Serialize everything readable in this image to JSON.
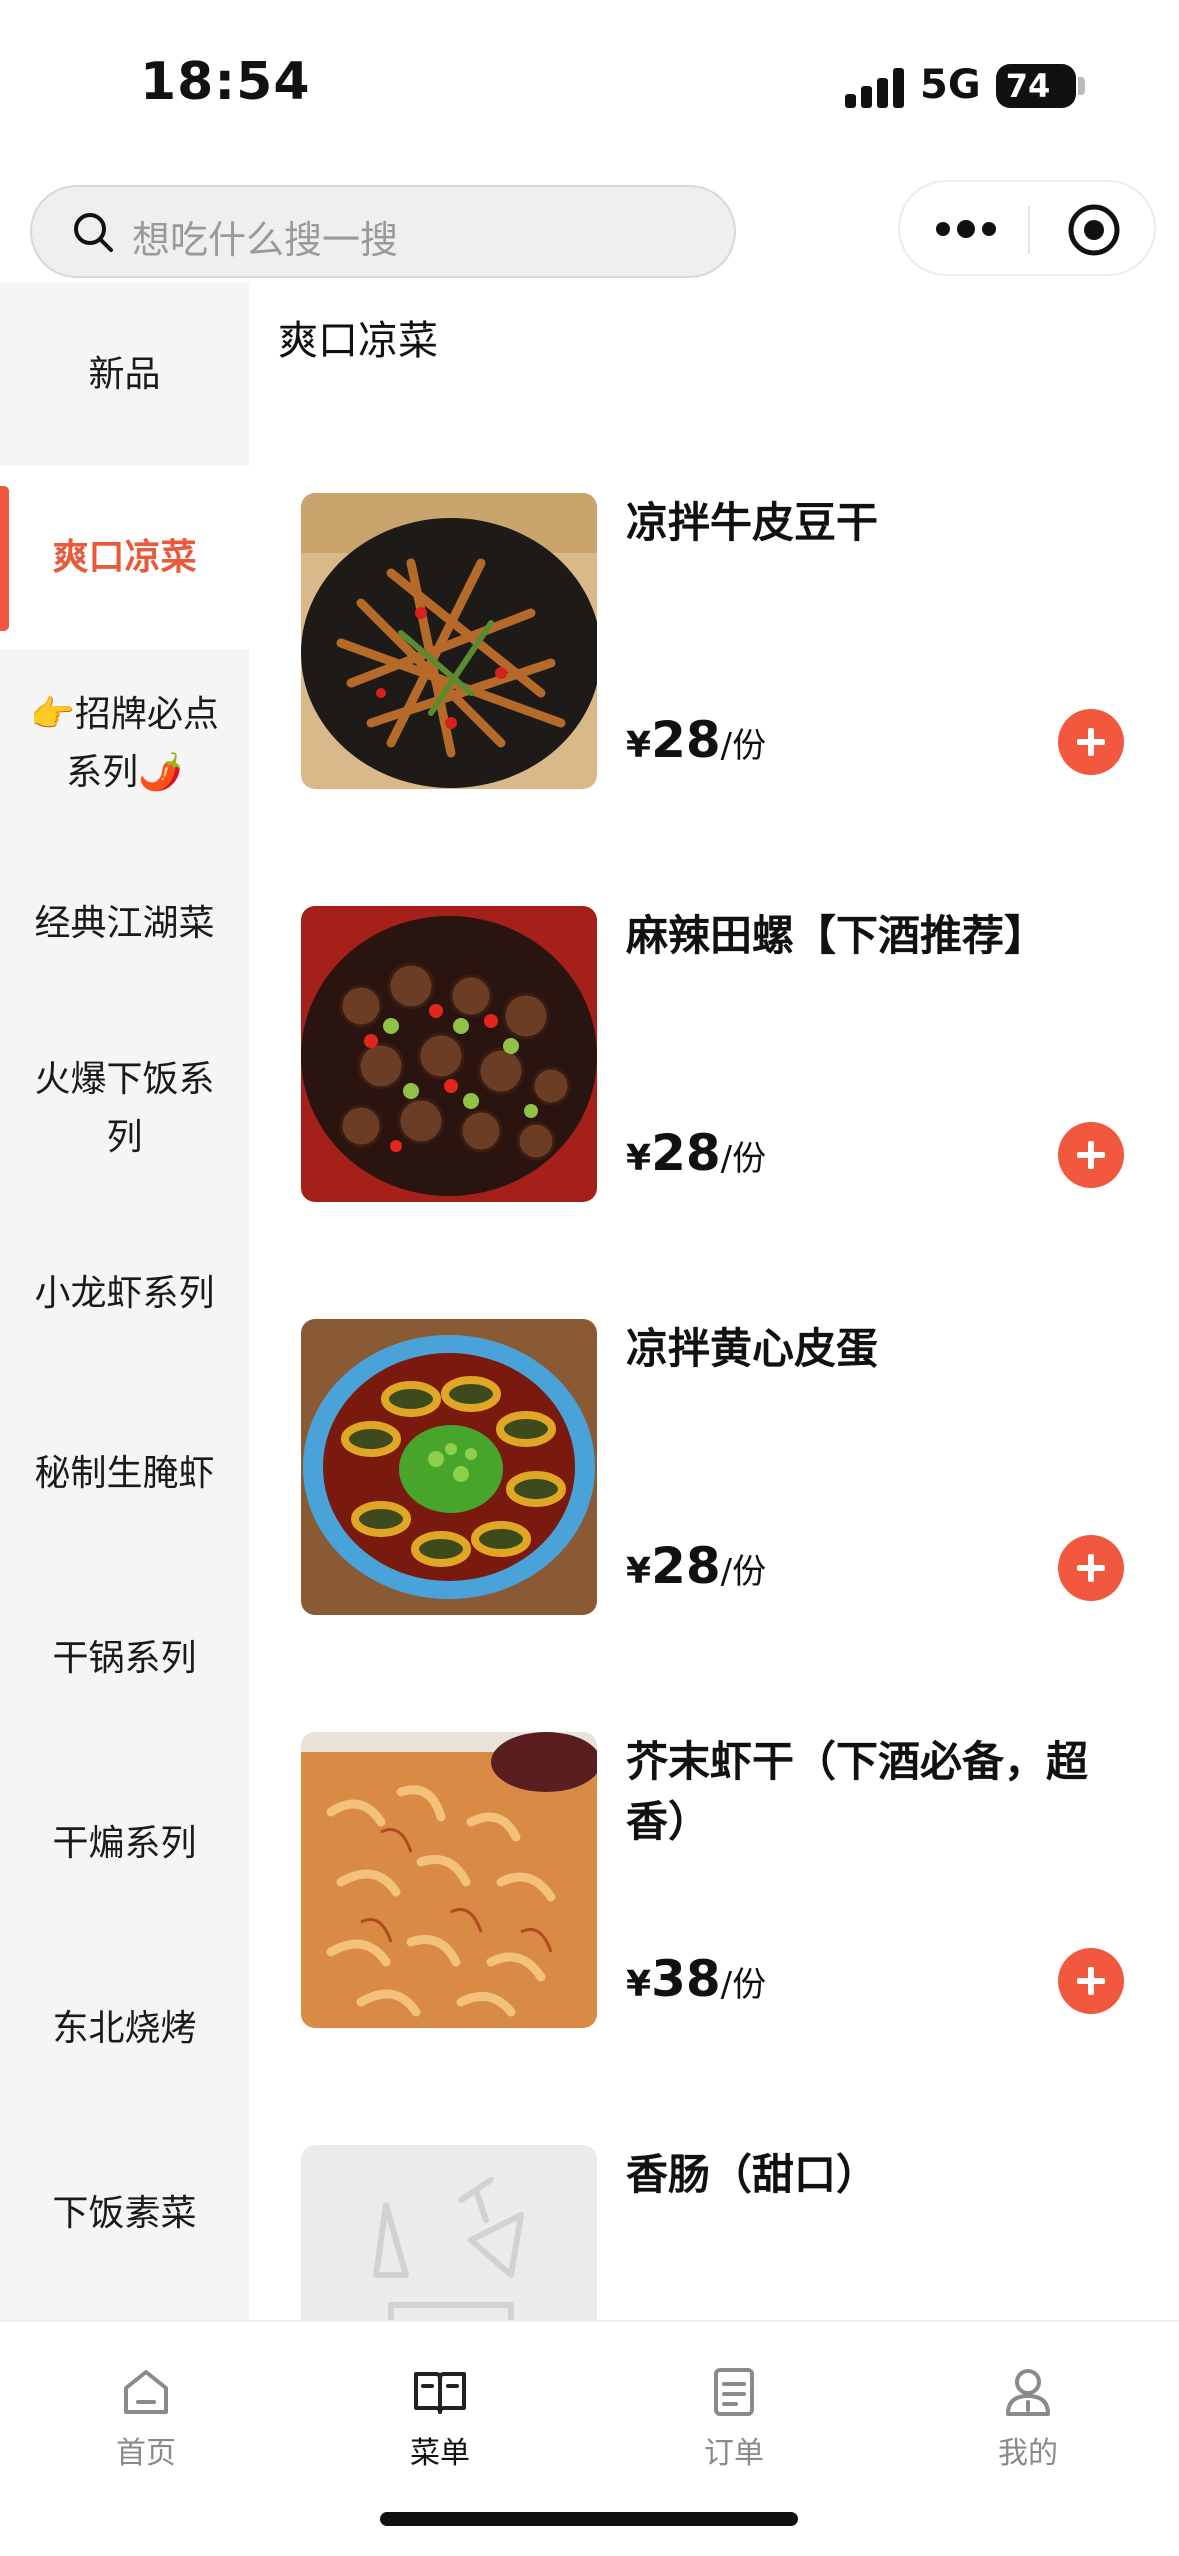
{
  "status_bar": {
    "time": "18:54",
    "network": "5G",
    "battery": "74"
  },
  "search": {
    "placeholder": "想吃什么搜一搜",
    "icon": "search-icon"
  },
  "capsule": {
    "more_icon": "more-dots-icon",
    "close_icon": "target-circle-icon"
  },
  "sidebar": {
    "items": [
      {
        "label": "新品"
      },
      {
        "label": "爽口凉菜",
        "active": true
      },
      {
        "label": "👉招牌必点系列🌶️"
      },
      {
        "label": "经典江湖菜"
      },
      {
        "label": "火爆下饭系列"
      },
      {
        "label": "小龙虾系列"
      },
      {
        "label": "秘制生腌虾"
      },
      {
        "label": "干锅系列"
      },
      {
        "label": "干煸系列"
      },
      {
        "label": "东北烧烤"
      },
      {
        "label": "下饭素菜"
      }
    ]
  },
  "main": {
    "section_title": "爽口凉菜",
    "dishes": [
      {
        "name": "凉拌牛皮豆干",
        "currency": "¥",
        "price": "28",
        "unit": "/份"
      },
      {
        "name": "麻辣田螺【下酒推荐】",
        "currency": "¥",
        "price": "28",
        "unit": "/份"
      },
      {
        "name": "凉拌黄心皮蛋",
        "currency": "¥",
        "price": "28",
        "unit": "/份"
      },
      {
        "name": "芥末虾干（下酒必备，超香）",
        "currency": "¥",
        "price": "38",
        "unit": "/份"
      },
      {
        "name": "香肠（甜口）"
      }
    ]
  },
  "tabbar": {
    "tabs": [
      {
        "label": "首页",
        "icon": "home-icon"
      },
      {
        "label": "菜单",
        "icon": "menu-book-icon",
        "active": true
      },
      {
        "label": "订单",
        "icon": "order-icon"
      },
      {
        "label": "我的",
        "icon": "profile-icon"
      }
    ]
  },
  "colors": {
    "accent": "#f2583e",
    "active_text": "#e85a3a",
    "sidebar_bg": "#f5f5f5"
  }
}
